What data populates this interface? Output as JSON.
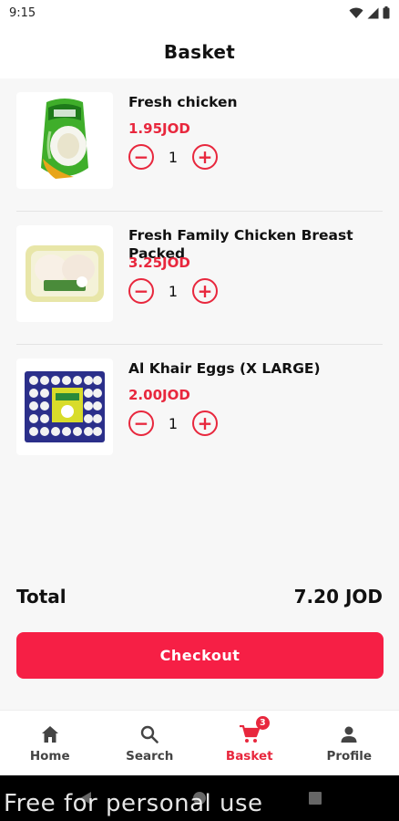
{
  "status_bar": {
    "time": "9:15"
  },
  "header": {
    "title": "Basket"
  },
  "items": [
    {
      "name": "Fresh chicken",
      "price": "1.95JOD",
      "quantity": "1",
      "image_icon": "whole-chicken-package-icon"
    },
    {
      "name": "Fresh Family Chicken Breast Packed",
      "price": "3.25JOD",
      "quantity": "1",
      "image_icon": "chicken-breast-tray-icon"
    },
    {
      "name": "Al Khair Eggs (X LARGE)",
      "price": "2.00JOD",
      "quantity": "1",
      "image_icon": "egg-tray-icon"
    }
  ],
  "summary": {
    "total_label": "Total",
    "total_value": "7.20 JOD"
  },
  "checkout": {
    "label": "Checkout"
  },
  "nav": {
    "home": "Home",
    "search": "Search",
    "basket": "Basket",
    "basket_badge": "3",
    "profile": "Profile"
  },
  "watermark": "Free for personal use",
  "colors": {
    "accent": "#e8273d",
    "button": "#f61f45"
  }
}
